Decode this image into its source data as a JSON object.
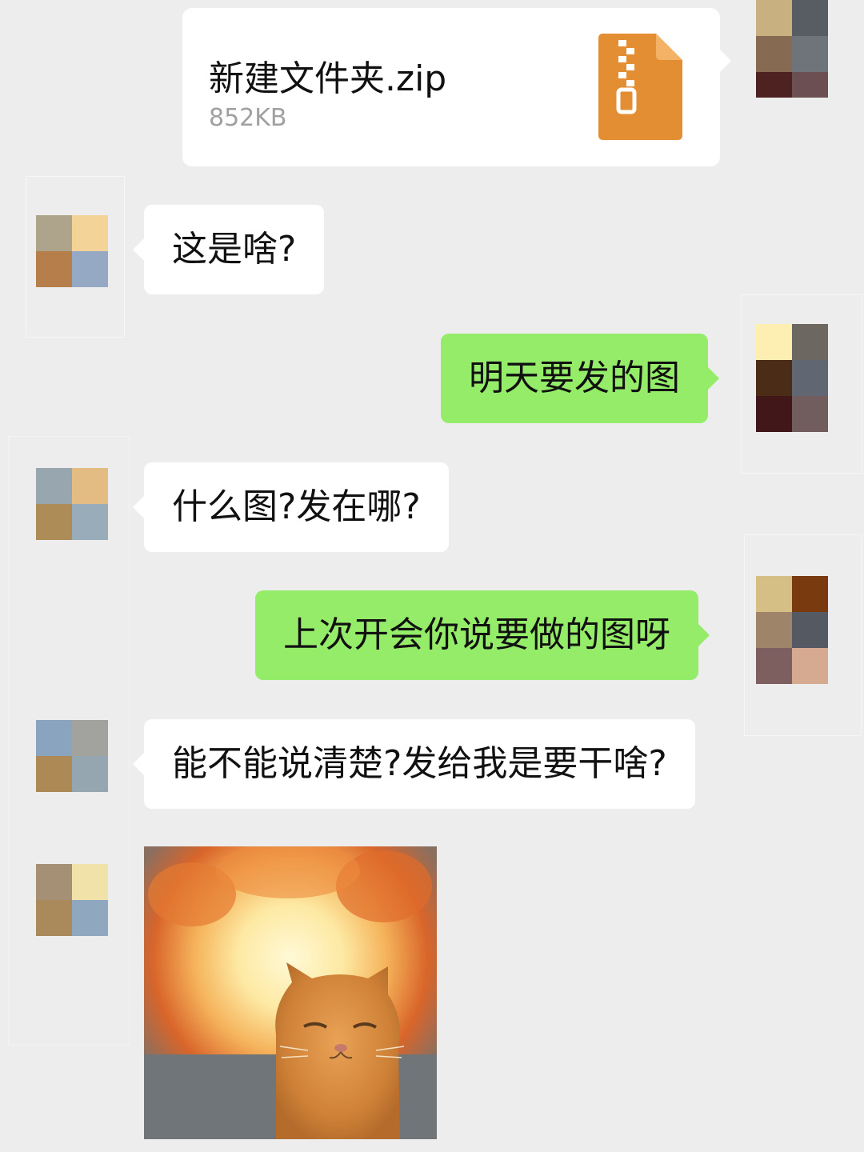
{
  "file_message": {
    "name": "新建文件夹.zip",
    "size": "852KB",
    "icon": "zip-file-icon"
  },
  "messages": [
    {
      "side": "left",
      "text": "这是啥?"
    },
    {
      "side": "right",
      "text": "明天要发的图"
    },
    {
      "side": "left",
      "text": "什么图?发在哪?"
    },
    {
      "side": "right",
      "text": "上次开会你说要做的图呀"
    },
    {
      "side": "left",
      "text": "能不能说清楚?发给我是要干啥?"
    }
  ],
  "sticker": {
    "type": "image",
    "subject": "cat-explosion-sticker"
  },
  "colors": {
    "background": "#ededed",
    "incoming_bubble": "#ffffff",
    "outgoing_bubble": "#95ec69",
    "zip_icon": "#e38e33"
  }
}
